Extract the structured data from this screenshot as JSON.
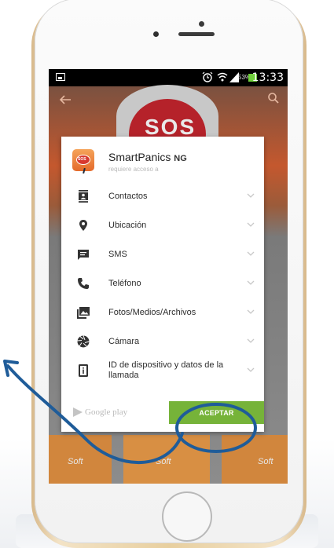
{
  "device": {
    "status_bar": {
      "battery_percent": "53%",
      "time": "13:33"
    }
  },
  "background_app": {
    "sos_label": "SOS",
    "thumbnail_labels": [
      "Soft",
      "Soft",
      "Soft"
    ]
  },
  "dialog": {
    "app_name": "SmartPanics",
    "app_name_suffix": "NG",
    "subtitle": "requiere acceso a",
    "permissions": [
      {
        "label": "Contactos",
        "icon": "contacts-icon"
      },
      {
        "label": "Ubicación",
        "icon": "location-pin-icon"
      },
      {
        "label": "SMS",
        "icon": "message-icon"
      },
      {
        "label": "Teléfono",
        "icon": "phone-icon"
      },
      {
        "label": "Fotos/Medios/Archivos",
        "icon": "photos-icon"
      },
      {
        "label": "Cámara",
        "icon": "camera-aperture-icon"
      },
      {
        "label": "ID de dispositivo y datos de la llamada",
        "icon": "device-id-icon"
      }
    ],
    "store_label": "Google play",
    "accept_label": "ACEPTAR"
  },
  "colors": {
    "accent_green": "#76b339",
    "annotation_blue": "#1f5c99",
    "sos_red": "#b5222a"
  }
}
